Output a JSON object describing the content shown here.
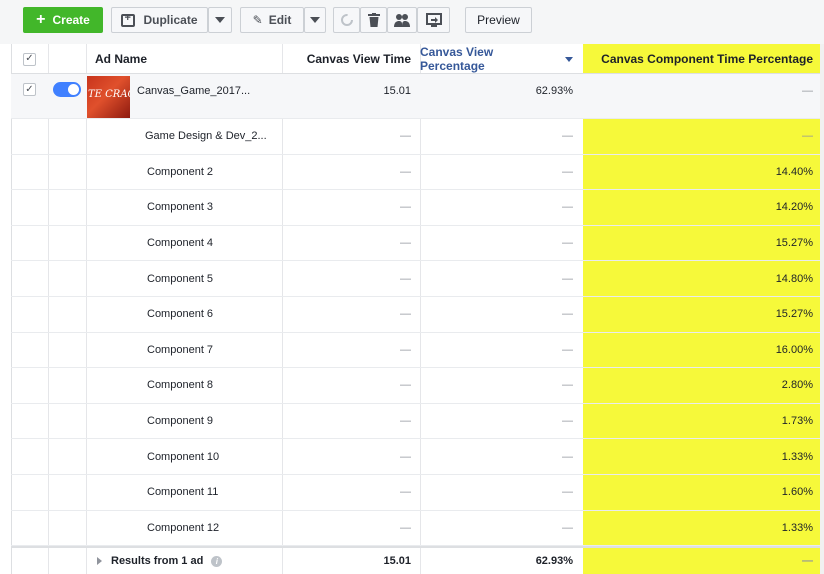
{
  "toolbar": {
    "create_label": "Create",
    "duplicate_label": "Duplicate",
    "edit_label": "Edit",
    "preview_label": "Preview",
    "icons": [
      "plus-icon",
      "duplicate-icon",
      "pencil-icon",
      "refresh-icon",
      "trash-icon",
      "people-icon",
      "preview-screen-icon"
    ]
  },
  "table": {
    "headers": {
      "ad_name": "Ad Name",
      "canvas_view_time": "Canvas View Time",
      "canvas_view_percentage": "Canvas View Percentage",
      "canvas_component_time_percentage": "Canvas Component Time Percentage"
    },
    "main_row": {
      "name": "Canvas_Game_2017...",
      "canvas_view_time": "15.01",
      "canvas_view_percentage": "62.93%",
      "canvas_component_time_percentage": "—",
      "thumbnail_text": "TE CRACKD",
      "checked": true,
      "active": true
    },
    "rows": [
      {
        "name": "Game Design & Dev_2...",
        "cvt": "—",
        "cvp": "—",
        "cct": "—"
      },
      {
        "name": "Component 2",
        "cvt": "—",
        "cvp": "—",
        "cct": "14.40%"
      },
      {
        "name": "Component 3",
        "cvt": "—",
        "cvp": "—",
        "cct": "14.20%"
      },
      {
        "name": "Component 4",
        "cvt": "—",
        "cvp": "—",
        "cct": "15.27%"
      },
      {
        "name": "Component 5",
        "cvt": "—",
        "cvp": "—",
        "cct": "14.80%"
      },
      {
        "name": "Component 6",
        "cvt": "—",
        "cvp": "—",
        "cct": "15.27%"
      },
      {
        "name": "Component 7",
        "cvt": "—",
        "cvp": "—",
        "cct": "16.00%"
      },
      {
        "name": "Component 8",
        "cvt": "—",
        "cvp": "—",
        "cct": "2.80%"
      },
      {
        "name": "Component 9",
        "cvt": "—",
        "cvp": "—",
        "cct": "1.73%"
      },
      {
        "name": "Component 10",
        "cvt": "—",
        "cvp": "—",
        "cct": "1.33%"
      },
      {
        "name": "Component 11",
        "cvt": "—",
        "cvp": "—",
        "cct": "1.60%"
      },
      {
        "name": "Component 12",
        "cvt": "—",
        "cvp": "—",
        "cct": "1.33%"
      }
    ],
    "footer": {
      "label": "Results from 1 ad",
      "canvas_view_time": "15.01",
      "canvas_view_percentage": "62.93%",
      "canvas_component_time_percentage": "—"
    }
  },
  "colors": {
    "create": "#42b72a",
    "highlight_column": "#f6f93a",
    "sorted_header": "#365899",
    "toggle_on": "#4080ff"
  }
}
